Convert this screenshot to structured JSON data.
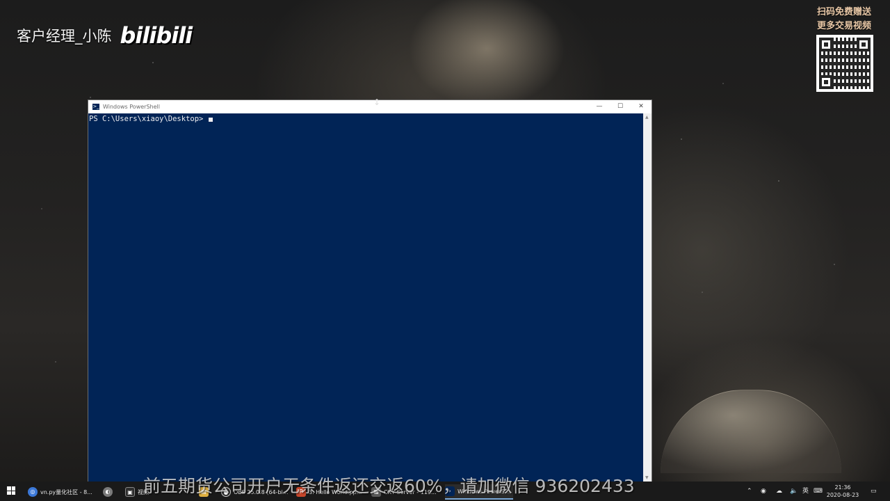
{
  "overlay": {
    "streamer_name": "客户经理_小陈",
    "logo_text": "bilibili",
    "promo_top_line1": "扫码免费赠送",
    "promo_top_line2": "更多交易视频",
    "banner": "前五期货公司开户无条件返还交返60%，请加微信 936202433"
  },
  "powershell": {
    "title": "Windows PowerShell",
    "icon_text": ">_",
    "minimize": "—",
    "maximize": "☐",
    "close": "✕",
    "prompt": "PS C:\\Users\\xiaoy\\Desktop>",
    "console_bg": "#012456"
  },
  "taskbar": {
    "items": [
      {
        "label": "vn.py量化社区 - 8...",
        "icon": "browser-icon",
        "color": "#3b78d8"
      },
      {
        "label": "",
        "icon": "app-icon",
        "color": "#7a7a7a"
      },
      {
        "label": "视频",
        "icon": "video-icon",
        "color": "#2e2e2e"
      },
      {
        "label": "",
        "icon": "file-icon",
        "color": "#e0b040"
      },
      {
        "label": "OBS 25.0.8 (64-bi...",
        "icon": "obs-icon",
        "color": "#303030"
      },
      {
        "label": "3. Hello World.pp...",
        "icon": "ppt-icon",
        "color": "#c8472b"
      },
      {
        "label": "CXY Server - 119...",
        "icon": "server-icon",
        "color": "#5a5a5a"
      },
      {
        "label": "Windows PowerS...",
        "icon": "powershell-icon",
        "color": "#012456"
      }
    ],
    "tray_lang": "英",
    "time": "21:36",
    "date": "2020-08-23"
  }
}
